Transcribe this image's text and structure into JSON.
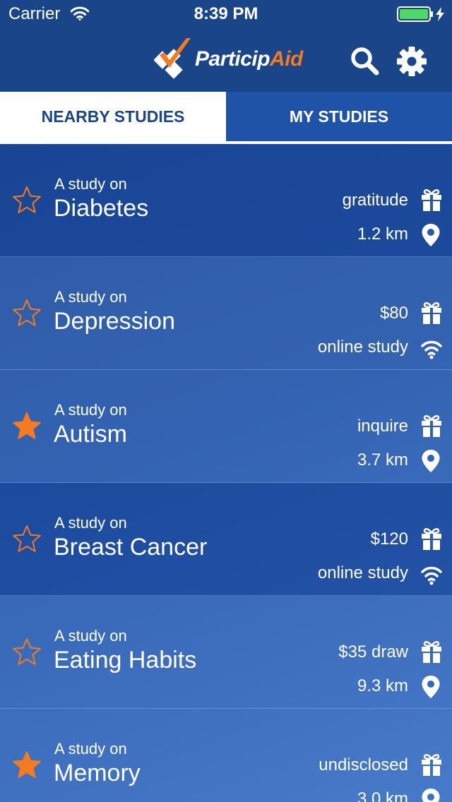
{
  "status": {
    "carrier": "Carrier",
    "time": "8:39 PM"
  },
  "header": {
    "logo_part1": "Particip",
    "logo_part2": "Aid",
    "icons": [
      "search-icon",
      "gear-icon"
    ]
  },
  "tabs": [
    {
      "label": "NEARBY STUDIES",
      "active": true
    },
    {
      "label": "MY STUDIES",
      "active": false
    }
  ],
  "studies": [
    {
      "prefix": "A study on",
      "title": "Diabetes",
      "compensation": "gratitude",
      "location": "1.2 km",
      "location_icon": "map-pin-icon",
      "favorited": false
    },
    {
      "prefix": "A study on",
      "title": "Depression",
      "compensation": "$80",
      "location": "online study",
      "location_icon": "wifi-icon",
      "favorited": false
    },
    {
      "prefix": "A study on",
      "title": "Autism",
      "compensation": "inquire",
      "location": "3.7 km",
      "location_icon": "map-pin-icon",
      "favorited": true
    },
    {
      "prefix": "A study on",
      "title": "Breast Cancer",
      "compensation": "$120",
      "location": "online study",
      "location_icon": "wifi-icon",
      "favorited": false
    },
    {
      "prefix": "A study on",
      "title": "Eating Habits",
      "compensation": "$35 draw",
      "location": "9.3 km",
      "location_icon": "map-pin-icon",
      "favorited": false
    },
    {
      "prefix": "A study on",
      "title": "Memory",
      "compensation": "undisclosed",
      "location": "3.0 km",
      "location_icon": "map-pin-icon",
      "favorited": true
    }
  ],
  "colors": {
    "accent": "#f47b20",
    "header": "#1a4589",
    "tab_active_text": "#1a4589",
    "tab_inactive_bg": "#1f53a8"
  }
}
